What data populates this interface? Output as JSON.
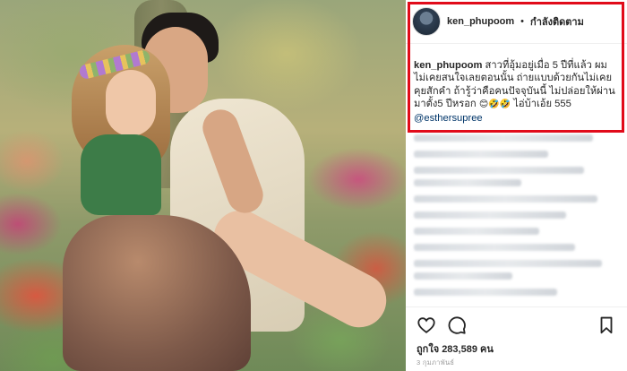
{
  "post": {
    "username": "ken_phupoom",
    "separator": "•",
    "follow_status": "กำลังติดตาม",
    "caption_user": "ken_phupoom",
    "caption_text": " สาวที่อุ้มอยู่เมื่อ 5 ปีที่แล้ว ผม ไม่เคยสนใจเลยตอนนั้น ถ่ายแบบด้วยกันไม่เคยคุยสักคำ ถ้ารู้ว่าคือคนปัจจุบันนี้ ไม่ปล่อยให้ผ่านมาตั้ง5 ปีหรอก ",
    "caption_emoji": "😊🤣🤣",
    "caption_tail": " ไอ่บ้าเอ้ย 555",
    "mention": "@esthersupree",
    "likes": "ถูกใจ 283,589 คน",
    "date": "3 กุมภาพันธ์"
  },
  "icons": {
    "like": "heart-icon",
    "comment": "comment-icon",
    "save": "bookmark-icon"
  },
  "colors": {
    "highlight": "#e10b1a",
    "mention": "#003569",
    "text": "#262626",
    "muted": "#999999"
  }
}
